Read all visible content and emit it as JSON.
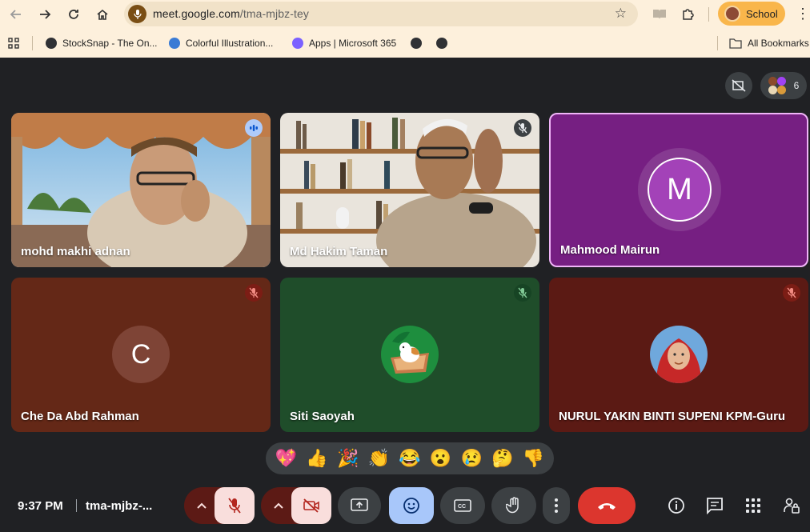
{
  "browser": {
    "url_host": "meet.google.com",
    "url_path": "/tma-mjbz-tey",
    "profile_label": "School",
    "bookmarks": [
      {
        "label": "StockSnap - The On...",
        "color": "#303134"
      },
      {
        "label": "Colorful Illustration...",
        "color": "#3a7bd5"
      },
      {
        "label": "Apps | Microsoft 365",
        "color": "#7b61ff"
      },
      {
        "label": "",
        "color": "#303134"
      },
      {
        "label": "",
        "color": "#303134"
      }
    ],
    "all_bookmarks_label": "All Bookmarks"
  },
  "meeting": {
    "participant_count": "6",
    "time": "9:37 PM",
    "code": "tma-mjbz-...",
    "participants": [
      {
        "name": "mohd makhi adnan",
        "state": "speaking",
        "type": "video"
      },
      {
        "name": "Md Hakim Taman",
        "state": "muted",
        "type": "video"
      },
      {
        "name": "Mahmood Mairun",
        "state": "pinned",
        "type": "avatar",
        "initial": "M",
        "color": "#7a1f86"
      },
      {
        "name": "Che Da Abd Rahman",
        "state": "muted",
        "type": "avatar",
        "initial": "C",
        "color": "#6b2b1c"
      },
      {
        "name": "Siti Saoyah",
        "state": "muted",
        "type": "avatar-image",
        "color": "#1e4f2a"
      },
      {
        "name": "NURUL YAKIN BINTI SUPENI KPM-Guru",
        "state": "muted",
        "type": "avatar-image",
        "color": "#5e1a15"
      }
    ]
  },
  "reactions": [
    "💖",
    "👍",
    "🎉",
    "👏",
    "😂",
    "😮",
    "😢",
    "🤔",
    "👎"
  ]
}
